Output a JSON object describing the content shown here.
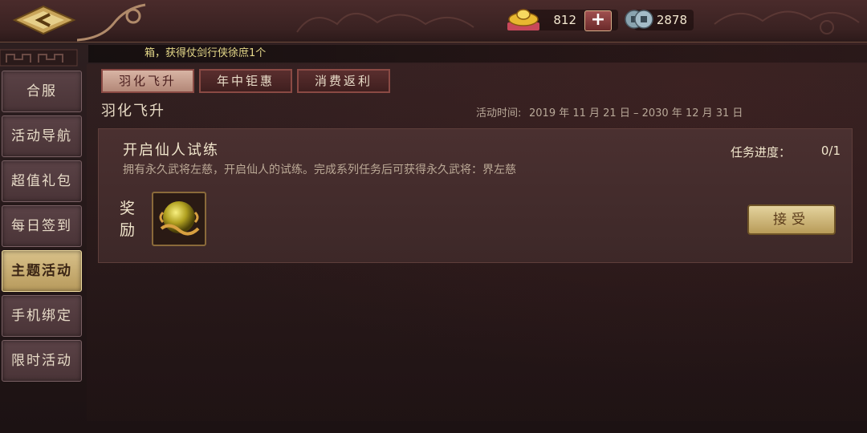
{
  "header": {
    "back_icon": "back-arrow-icon",
    "gold": {
      "icon": "gold-ingot-icon",
      "value": "812",
      "add_label": "+"
    },
    "coins": {
      "icon": "copper-coins-icon",
      "value": "2878"
    }
  },
  "notice": {
    "text": "箱，获得仗剑行侠徐庶1个"
  },
  "sidebar": {
    "items": [
      {
        "label": "合服",
        "active": false
      },
      {
        "label": "活动导航",
        "active": false
      },
      {
        "label": "超值礼包",
        "active": false
      },
      {
        "label": "每日签到",
        "active": false
      },
      {
        "label": "主题活动",
        "active": true
      },
      {
        "label": "手机绑定",
        "active": false
      },
      {
        "label": "限时活动",
        "active": false
      }
    ]
  },
  "tabs": [
    {
      "label": "羽化飞升",
      "active": true
    },
    {
      "label": "年中钜惠",
      "active": false
    },
    {
      "label": "消费返利",
      "active": false
    }
  ],
  "section": {
    "title": "羽化飞升",
    "time_label": "活动时间:",
    "time_range": "2019 年 11 月 21 日  – 2030 年 12 月 31 日"
  },
  "task": {
    "title": "开启仙人试练",
    "description": "拥有永久武将左慈，开启仙人的试练。完成系列任务后可获得永久武将：界左慈",
    "progress_label": "任务进度：",
    "progress_value": "0/1",
    "reward_label": "奖励",
    "reward_icon": "golden-orb-icon",
    "accept_label": "接受"
  },
  "colors": {
    "accent_gold": "#d9c18a",
    "tab_active": "#d8b4a4",
    "notice_text": "#e6d98a"
  }
}
